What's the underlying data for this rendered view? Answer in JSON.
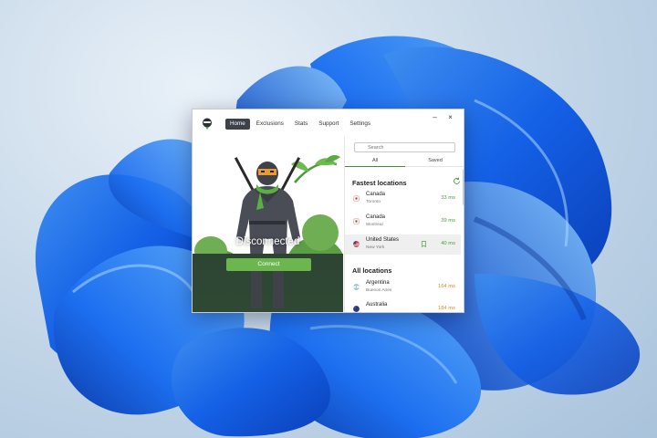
{
  "colors": {
    "accent_green": "#6bb64d",
    "latency_green": "#4aa043",
    "latency_orange": "#e08a1e",
    "nav_active": "#3d4148"
  },
  "window": {
    "logo_icon": "ninja-logo-icon",
    "nav": [
      "Home",
      "Exclusions",
      "Stats",
      "Support",
      "Settings"
    ],
    "active_nav": "Home",
    "controls": {
      "minimize": "–",
      "close": "×"
    }
  },
  "hero": {
    "status": "Disconnected",
    "connect_label": "Connect"
  },
  "sidebar": {
    "search_placeholder": "Search",
    "tabs": [
      "All",
      "Saved"
    ],
    "fastest_title": "Fastest locations",
    "fastest": [
      {
        "country": "Canada",
        "city": "Toronto",
        "latency": "33 ms",
        "flag": "canada-flag-icon",
        "level": "good"
      },
      {
        "country": "Canada",
        "city": "Montreal",
        "latency": "39 ms",
        "flag": "canada-flag-icon",
        "level": "good"
      },
      {
        "country": "United States",
        "city": "New York",
        "latency": "40 ms",
        "flag": "us-flag-icon",
        "level": "good"
      }
    ],
    "all_title": "All locations",
    "all": [
      {
        "country": "Argentina",
        "city": "Buenos Aires",
        "latency": "164 ms",
        "flag": "argentina-flag-icon",
        "level": "slow"
      },
      {
        "country": "Australia",
        "city": "",
        "latency": "184 ms",
        "flag": "australia-flag-icon",
        "level": "slow"
      }
    ]
  }
}
